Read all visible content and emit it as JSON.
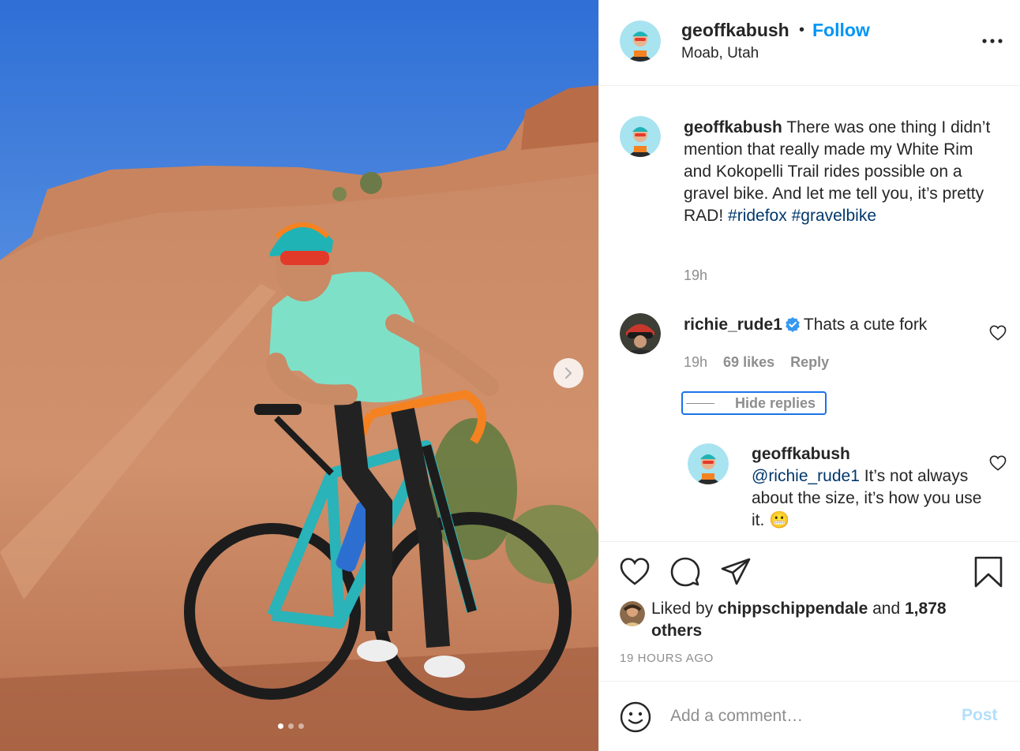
{
  "post": {
    "image_alt": "Cyclist standing with a teal gravel bike on red slickrock",
    "carousel": {
      "count": 3,
      "active": 0
    }
  },
  "header": {
    "username": "geoffkabush",
    "separator": "•",
    "follow_label": "Follow",
    "location": "Moab, Utah"
  },
  "caption": {
    "username": "geoffkabush",
    "text": "There was one thing I didn’t mention that really made my White Rim and Kokopelli Trail rides possible on a gravel bike. And let me tell you, it’s pretty RAD!",
    "hashtags": [
      "#ridefox",
      "#gravelbike"
    ],
    "time": "19h"
  },
  "comments": [
    {
      "username": "richie_rude1",
      "verified": true,
      "text": "Thats a cute fork",
      "time": "19h",
      "likes": "69 likes",
      "reply_label": "Reply",
      "hide_replies_label": "Hide replies",
      "replies": [
        {
          "username": "geoffkabush",
          "mention": "@richie_rude1",
          "text": "It’s not always about the size, it’s how you use it. 😬"
        }
      ]
    }
  ],
  "actions": {
    "liked_by_prefix": "Liked by",
    "liked_by_user": "chippschippendale",
    "liked_by_and": "and",
    "others": "1,878 others",
    "time_ago": "19 HOURS AGO"
  },
  "add_comment": {
    "placeholder": "Add a comment…",
    "post_label": "Post"
  },
  "colors": {
    "accent": "#0095f6",
    "hashtag": "#00376b",
    "muted": "#8e8e8e",
    "post_disabled": "#b3dffc"
  }
}
